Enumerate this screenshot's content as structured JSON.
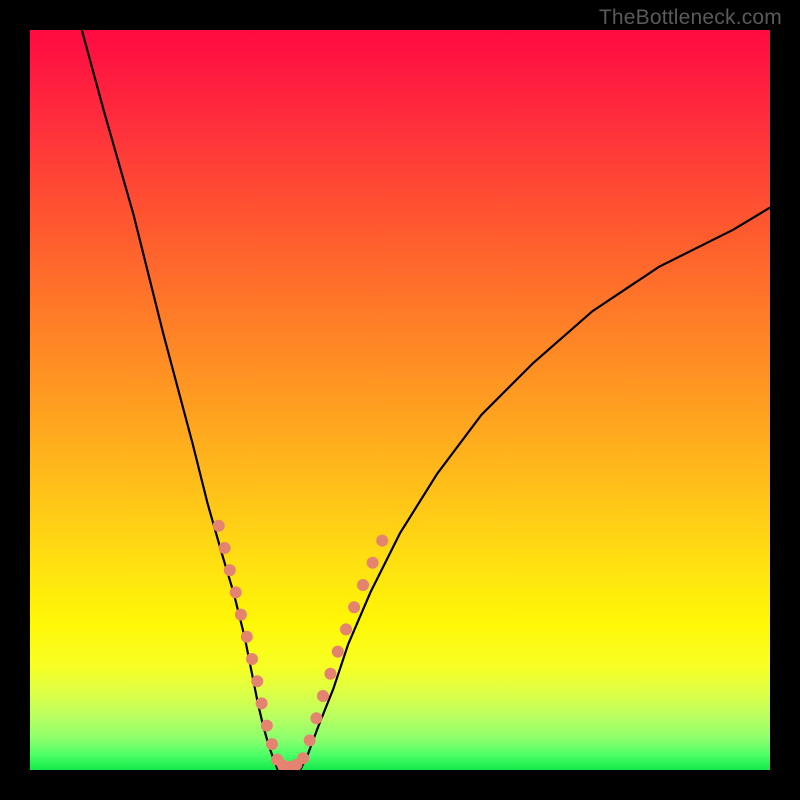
{
  "watermark": "TheBottleneck.com",
  "colors": {
    "background": "#000000",
    "curve": "#000000",
    "dots": "#e4836f",
    "gradient_top": "#ff0a42",
    "gradient_bottom": "#12e94a"
  },
  "chart_data": {
    "type": "line",
    "title": "",
    "xlabel": "",
    "ylabel": "",
    "xlim": [
      0,
      100
    ],
    "ylim": [
      0,
      100
    ],
    "series": [
      {
        "name": "left-curve",
        "x": [
          7,
          10,
          14,
          18,
          22,
          24,
          26,
          27.5,
          29,
          30,
          30.8,
          31.5,
          32.2,
          33,
          33.5
        ],
        "y": [
          100,
          89,
          75,
          59,
          44,
          36,
          29,
          24,
          18,
          13,
          9,
          6,
          3.5,
          1.2,
          0
        ]
      },
      {
        "name": "right-curve",
        "x": [
          36.5,
          37.5,
          39,
          41,
          43,
          46,
          50,
          55,
          61,
          68,
          76,
          85,
          95,
          100
        ],
        "y": [
          0,
          2,
          6,
          11,
          17,
          24,
          32,
          40,
          48,
          55,
          62,
          68,
          73,
          76
        ]
      }
    ],
    "points": [
      {
        "name": "left-cluster",
        "x": 25.5,
        "y": 33
      },
      {
        "name": "left-cluster",
        "x": 26.3,
        "y": 30
      },
      {
        "name": "left-cluster",
        "x": 27.0,
        "y": 27
      },
      {
        "name": "left-cluster",
        "x": 27.8,
        "y": 24
      },
      {
        "name": "left-cluster",
        "x": 28.5,
        "y": 21
      },
      {
        "name": "left-cluster",
        "x": 29.3,
        "y": 18
      },
      {
        "name": "left-cluster",
        "x": 30.0,
        "y": 15
      },
      {
        "name": "left-cluster",
        "x": 30.7,
        "y": 12
      },
      {
        "name": "left-cluster",
        "x": 31.3,
        "y": 9
      },
      {
        "name": "left-cluster",
        "x": 32.0,
        "y": 6
      },
      {
        "name": "left-cluster",
        "x": 32.7,
        "y": 3.5
      },
      {
        "name": "valley",
        "x": 33.4,
        "y": 1.4
      },
      {
        "name": "valley",
        "x": 34.2,
        "y": 0.6
      },
      {
        "name": "valley",
        "x": 35.1,
        "y": 0.4
      },
      {
        "name": "valley",
        "x": 36.0,
        "y": 0.7
      },
      {
        "name": "valley",
        "x": 36.9,
        "y": 1.6
      },
      {
        "name": "right-cluster",
        "x": 37.8,
        "y": 4
      },
      {
        "name": "right-cluster",
        "x": 38.7,
        "y": 7
      },
      {
        "name": "right-cluster",
        "x": 39.6,
        "y": 10
      },
      {
        "name": "right-cluster",
        "x": 40.6,
        "y": 13
      },
      {
        "name": "right-cluster",
        "x": 41.6,
        "y": 16
      },
      {
        "name": "right-cluster",
        "x": 42.7,
        "y": 19
      },
      {
        "name": "right-cluster",
        "x": 43.8,
        "y": 22
      },
      {
        "name": "right-cluster",
        "x": 45.0,
        "y": 25
      },
      {
        "name": "right-cluster",
        "x": 46.3,
        "y": 28
      },
      {
        "name": "right-cluster",
        "x": 47.6,
        "y": 31
      }
    ]
  }
}
